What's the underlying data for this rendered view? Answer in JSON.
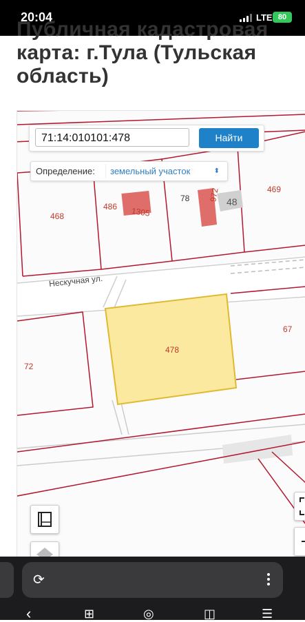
{
  "status_bar": {
    "time": "20:04",
    "network": "LTE",
    "battery": "80"
  },
  "page": {
    "title": "Публичная кадастровая карта: г.Тула (Тульская область)"
  },
  "search": {
    "value": "71:14:010101:478",
    "button_label": "Найти"
  },
  "definition": {
    "label": "Определение:",
    "selected": "земельный участок"
  },
  "map": {
    "parcel_labels": [
      "468",
      "486",
      "1305",
      "78",
      "972",
      "48",
      "469",
      "478",
      "67",
      "72"
    ],
    "street_label": "Нескучная ул.",
    "highlight_color": "#fbe9a0",
    "boundary_color": "#b3162d",
    "building_color": "#d9534f"
  },
  "browser": {
    "reload_icon": "reload-icon",
    "more_icon": "more-vertical-icon"
  }
}
